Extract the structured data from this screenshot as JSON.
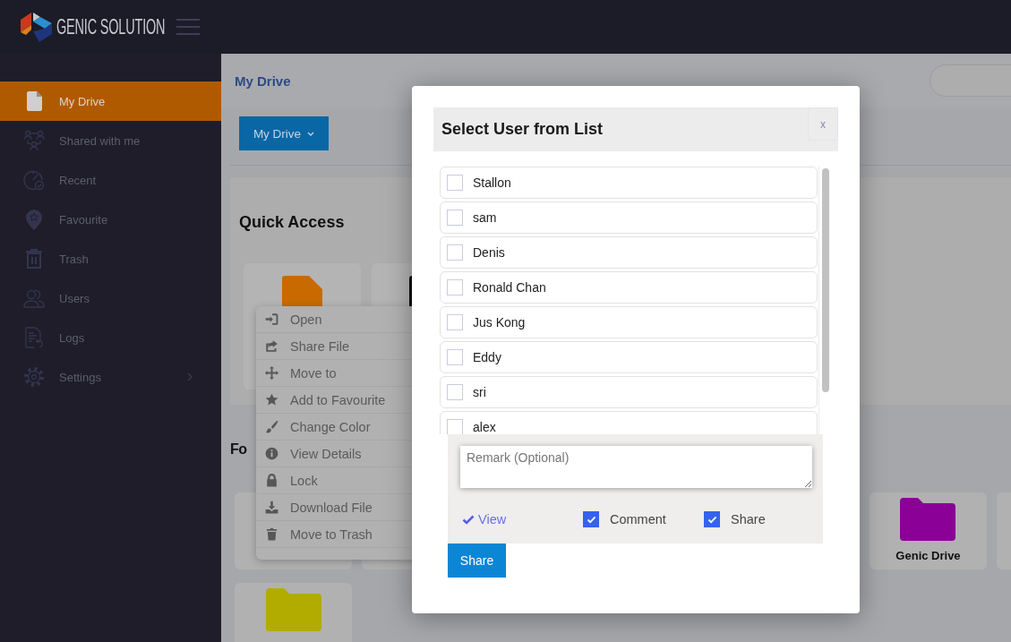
{
  "header": {
    "logo_text": "GENIC SOLUTION"
  },
  "sidebar": {
    "items": [
      {
        "label": "My Drive",
        "selected": true,
        "submenu": false
      },
      {
        "label": "Shared with me",
        "selected": false,
        "submenu": false
      },
      {
        "label": "Recent",
        "selected": false,
        "submenu": false
      },
      {
        "label": "Favourite",
        "selected": false,
        "submenu": false
      },
      {
        "label": "Trash",
        "selected": false,
        "submenu": false
      },
      {
        "label": "Users",
        "selected": false,
        "submenu": false
      },
      {
        "label": "Logs",
        "selected": false,
        "submenu": false
      },
      {
        "label": "Settings",
        "selected": false,
        "submenu": true
      }
    ]
  },
  "page": {
    "title": "My Drive",
    "drive_button": "My Drive"
  },
  "quick_access": {
    "title": "Quick Access",
    "files": [
      {
        "color": "#c86a00"
      },
      {
        "color": "#111111"
      }
    ]
  },
  "folders": {
    "title": "Fo",
    "items": [
      {
        "label": "Genic Drive",
        "color": "#8b0096"
      },
      {
        "color": "#b2ab00"
      }
    ]
  },
  "context_menu": {
    "items": [
      "Open",
      "Share File",
      "Move to",
      "Add to Favourite",
      "Change Color",
      "View Details",
      "Lock",
      "Download File",
      "Move to Trash"
    ]
  },
  "dialog": {
    "title": "Select User from List",
    "close": "x",
    "users": [
      {
        "name": "Stallon",
        "checked": false
      },
      {
        "name": "sam",
        "checked": false
      },
      {
        "name": "Denis",
        "checked": false
      },
      {
        "name": "Ronald Chan",
        "checked": false
      },
      {
        "name": "Jus Kong",
        "checked": false
      },
      {
        "name": "Eddy",
        "checked": false
      },
      {
        "name": "sri",
        "checked": false
      },
      {
        "name": "alex",
        "checked": false
      }
    ],
    "remark": {
      "placeholder": "Remark (Optional)"
    },
    "permissions": [
      {
        "label": "View",
        "kind": "tick",
        "checked": true
      },
      {
        "label": "Comment",
        "kind": "checkbox",
        "checked": true
      },
      {
        "label": "Share",
        "kind": "checkbox",
        "checked": true
      }
    ],
    "submit": "Share"
  }
}
